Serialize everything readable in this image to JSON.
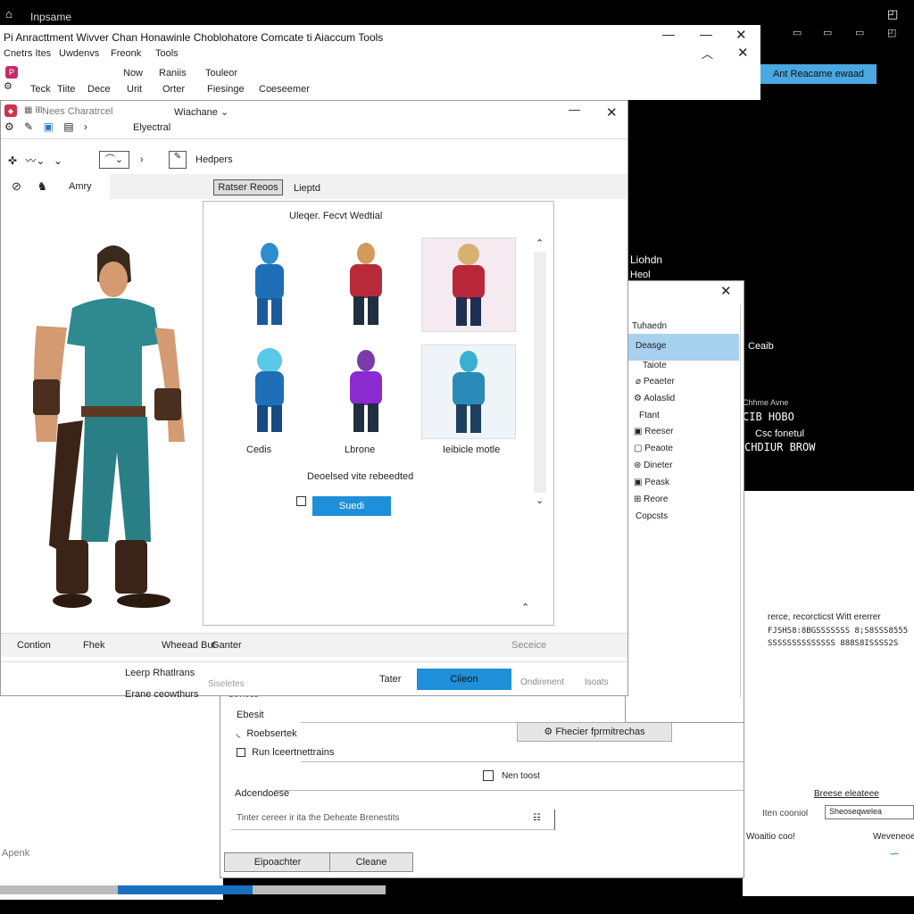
{
  "os": {
    "title": "Inpsame"
  },
  "main": {
    "title": "Pi Anracttment Wivver Chan Honawinle Choblohatore Comcate ti Aiaccum Tools",
    "menu": [
      "Cnetrs Ites",
      "Uwdenvs",
      "Freonk",
      "Tools"
    ],
    "toolbar": [
      "Teck",
      "Tiite",
      "Dece",
      "Urit",
      "Orter",
      "Fiesinge",
      "Coeseemer"
    ],
    "toolbar_top": [
      "Now",
      "Raniis",
      "Touleor"
    ],
    "right_button": "Ant Reacame ewaad"
  },
  "editor": {
    "title": "Nees Charatrcel",
    "dropdown": "Wiachane",
    "breadcrumb": "Elyectral",
    "sub_tool": "Hedpers",
    "side_label": "Amry",
    "tab_active": "Ratser Reoos",
    "tab_other": "Lieptd",
    "gallery_header": "Uleqer. Fecvt Wedtial",
    "thumb_labels": [
      "Cedis",
      "Lbrone",
      "Ieibicle motle"
    ],
    "gallery_note": "Deoelsed vite rebeedted",
    "gallery_button": "Suedi",
    "bottom_fields": [
      "Contion",
      "Fhek",
      "Wheead Bur",
      "Ganter",
      "Seceice"
    ],
    "footer_left": [
      "Leerp Rhatlrans",
      "Erane ceowthurs"
    ],
    "footer_label": "Siseletes",
    "footer_buttons": [
      "Tater",
      "Ciieon",
      "Ondinment",
      "Isoats"
    ]
  },
  "terminal": {
    "lines": [
      "Liohdn",
      "Heol",
      "Ceaib",
      "Chhme Avne",
      "CIB HOBO",
      "Csc fonetul",
      "CHDIUR BROW"
    ]
  },
  "options": {
    "items": [
      "Tuhaedn",
      "Deasge",
      "Taiote",
      "Peaeter",
      "Aolaslid",
      "Ftant",
      "Reeser",
      "Peaote",
      "Dineter",
      "Peask",
      "Reore",
      "Copcsts"
    ],
    "selected_index": 1
  },
  "lower": {
    "label1": "Ctrhocs",
    "label2": "Ebesit",
    "radio": "Roebsertek",
    "checkbox": "Run lceertnettrains",
    "action_button": "Fhecier fprmitrechas",
    "checkbox2": "Nen toost",
    "adv_label": "Adcendoese",
    "adv_input": "Tinter cereer ir ita the Deheate Brenestits",
    "buttons": [
      "Eipoachter",
      "Cleane"
    ]
  },
  "right_text": {
    "line1": "rerce, recorcticst Witt ererrer",
    "line2": "FJSHS8:8BGSSSSSSS 8;S8SSS8555",
    "line3": "SSSSSSSSSSSSSS 888S8ISSSS2S",
    "link": "Breese eleateee",
    "row1a": "Iten cooniol",
    "row1b": "Sheoseqwelea",
    "row2a": "Woaitio coo!",
    "row2b": "Weveneoe"
  },
  "bottom_left": "Apenk",
  "progress": 0.35,
  "colors": {
    "accent": "#1e8fd8",
    "selected": "#a8d1f0",
    "teal": "#2e8a8f"
  }
}
